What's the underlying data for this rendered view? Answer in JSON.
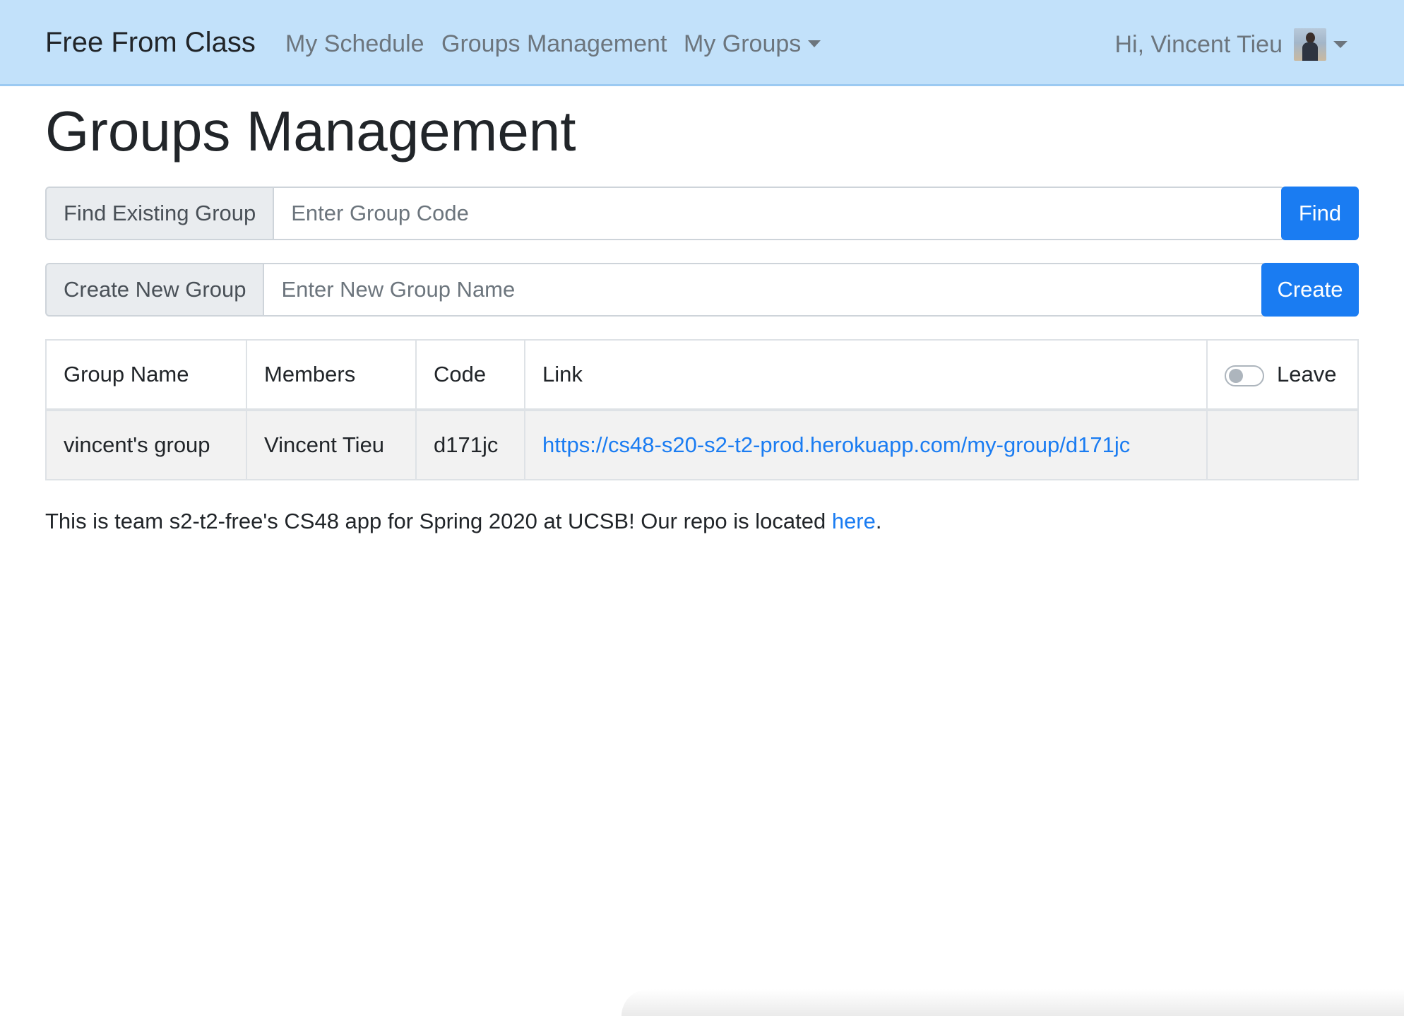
{
  "navbar": {
    "brand": "Free From Class",
    "links": [
      "My Schedule",
      "Groups Management",
      "My Groups"
    ],
    "greeting": "Hi, Vincent Tieu"
  },
  "page": {
    "title": "Groups Management"
  },
  "find_group": {
    "label": "Find Existing Group",
    "placeholder": "Enter Group Code",
    "value": "",
    "button": "Find"
  },
  "create_group": {
    "label": "Create New Group",
    "placeholder": "Enter New Group Name",
    "value": "",
    "button": "Create"
  },
  "table": {
    "headers": [
      "Group Name",
      "Members",
      "Code",
      "Link",
      "Leave"
    ],
    "leave_toggle_on": false,
    "rows": [
      {
        "group_name": "vincent's group",
        "members": "Vincent Tieu",
        "code": "d171jc",
        "link": "https://cs48-s20-s2-t2-prod.herokuapp.com/my-group/d171jc"
      }
    ]
  },
  "footer": {
    "text": "This is team s2-t2-free's CS48 app for Spring 2020 at UCSB! Our repo is located ",
    "link_text": "here",
    "end": "."
  },
  "colors": {
    "navbar_bg": "#c2e1fa",
    "primary": "#1a7cf2"
  }
}
